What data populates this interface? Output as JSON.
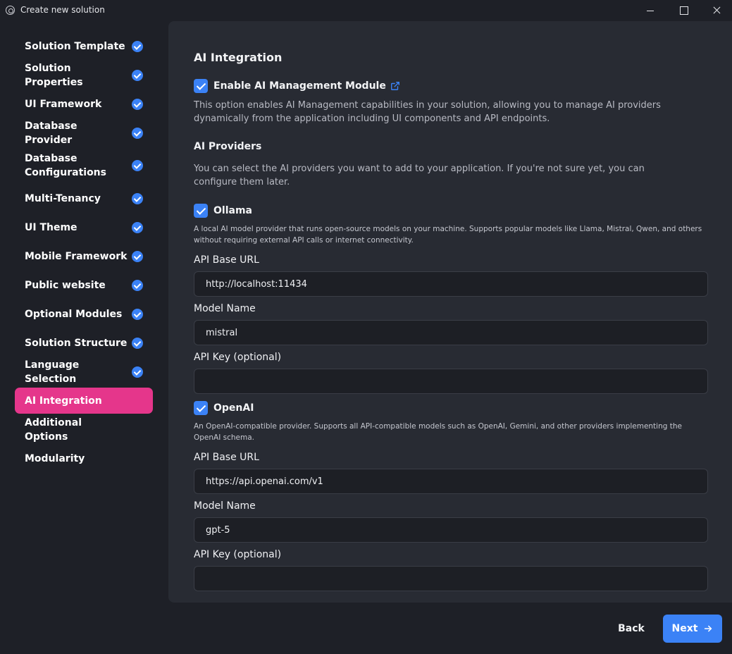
{
  "window": {
    "title": "Create new solution"
  },
  "sidebar": {
    "items": [
      {
        "label": "Solution Template",
        "completed": true
      },
      {
        "label": "Solution Properties",
        "completed": true
      },
      {
        "label": "UI Framework",
        "completed": true
      },
      {
        "label": "Database Provider",
        "completed": true
      },
      {
        "label": "Database Configurations",
        "completed": true
      },
      {
        "label": "Multi-Tenancy",
        "completed": true
      },
      {
        "label": "UI Theme",
        "completed": true
      },
      {
        "label": "Mobile Framework",
        "completed": true
      },
      {
        "label": "Public website",
        "completed": true
      },
      {
        "label": "Optional Modules",
        "completed": true
      },
      {
        "label": "Solution Structure",
        "completed": true
      },
      {
        "label": "Language Selection",
        "completed": true
      },
      {
        "label": "AI Integration",
        "completed": false,
        "active": true
      },
      {
        "label": "Additional Options",
        "completed": false
      },
      {
        "label": "Modularity",
        "completed": false
      }
    ],
    "active_color": "#e5368b",
    "check_color": "#3b82f6"
  },
  "main": {
    "title": "AI Integration",
    "enable_module": {
      "label": "Enable AI Management Module",
      "checked": true,
      "icon": "external-link-icon",
      "description": "This option enables AI Management capabilities in your solution, allowing you to manage AI providers dynamically from the application including UI components and API endpoints."
    },
    "providers_title": "AI Providers",
    "providers_description": "You can select the AI providers you want to add to your application. If you're not sure yet, you can configure them later.",
    "ollama": {
      "label": "Ollama",
      "checked": true,
      "description": "A local AI model provider that runs open-source models on your machine. Supports popular models like Llama, Mistral, Qwen, and others without requiring external API calls or internet connectivity.",
      "base_url_label": "API Base URL",
      "base_url_value": "http://localhost:11434",
      "model_label": "Model Name",
      "model_value": "mistral",
      "api_key_label": "API Key (optional)",
      "api_key_value": ""
    },
    "openai": {
      "label": "OpenAI",
      "checked": true,
      "description": "An OpenAI-compatible provider. Supports all API-compatible models such as OpenAI, Gemini, and other providers implementing the OpenAI schema.",
      "base_url_label": "API Base URL",
      "base_url_value": "https://api.openai.com/v1",
      "model_label": "Model Name",
      "model_value": "gpt-5",
      "api_key_label": "API Key (optional)",
      "api_key_value": ""
    }
  },
  "footer": {
    "back_label": "Back",
    "next_label": "Next",
    "next_icon": "arrow-right-icon",
    "accent": "#3b82f6"
  }
}
